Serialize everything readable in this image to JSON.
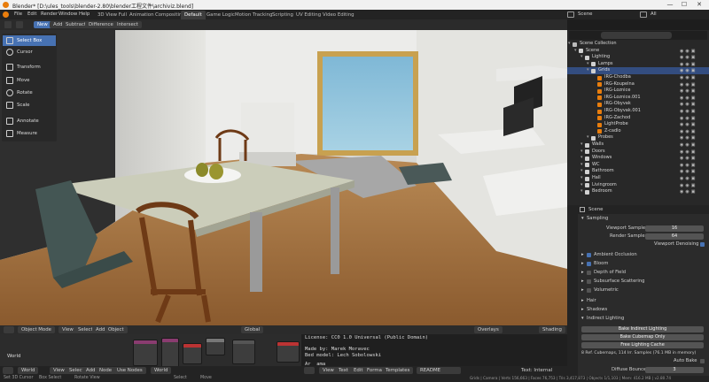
{
  "titlebar": {
    "title": "Blender* [D:\\ules_tools\\blender-2.80\\blender工程文件\\archiviz.blend]",
    "min": "—",
    "max": "☐",
    "close": "✕"
  },
  "menu": [
    "File",
    "Edit",
    "Render",
    "Window",
    "Help"
  ],
  "workspaces": [
    "3D View Full",
    "Animation",
    "Compositing",
    "Default",
    "Game Logic",
    "Motion Tracking",
    "Scripting",
    "UV Editing",
    "Video Editing"
  ],
  "workspace_active": "Default",
  "scene_label": "Scene",
  "viewlayer_label": "All",
  "tool_header": {
    "new": "New",
    "add": "Add",
    "subtract": "Subtract",
    "difference": "Difference",
    "intersect": "Intersect"
  },
  "tools": [
    "Select Box",
    "Cursor",
    "Transform",
    "Move",
    "Rotate",
    "Scale",
    "Annotate",
    "Measure"
  ],
  "vp_footer": {
    "mode": "Object Mode",
    "view": "View",
    "select": "Select",
    "add": "Add",
    "object": "Object",
    "orientation": "Global",
    "overlays": "Overlays",
    "shading": "Shading"
  },
  "node_editor": {
    "world_label": "World",
    "header": {
      "editor": "World",
      "view": "View",
      "select": "Select",
      "add": "Add",
      "node": "Node",
      "use_nodes": "Use Nodes",
      "world": "World"
    }
  },
  "text_editor": {
    "lines": [
      "License: CC0 1.0 Universal (Public Domain)",
      "",
      "Made by: Marek Moravec",
      "Bed model: Lech Sobolowski",
      "",
      "Ar  ama  "
    ],
    "header": {
      "view": "View",
      "text": "Text",
      "edit": "Edit",
      "format": "Format",
      "templates": "Templates",
      "file": "README",
      "status": "Text: Internal"
    }
  },
  "outliner": {
    "search_placeholder": "",
    "rows": [
      {
        "label": "Scene Collection",
        "indent": 0
      },
      {
        "label": "Scene",
        "indent": 1
      },
      {
        "label": "Lighting",
        "indent": 2
      },
      {
        "label": "Lamps",
        "indent": 3
      },
      {
        "label": "Grids",
        "indent": 3,
        "selected": true
      },
      {
        "label": "IRG-Chodba",
        "indent": 4
      },
      {
        "label": "IRG-Koupelna",
        "indent": 4
      },
      {
        "label": "IRG-Loznice",
        "indent": 4
      },
      {
        "label": "IRG-Loznice.001",
        "indent": 4
      },
      {
        "label": "IRG-Obyvak",
        "indent": 4
      },
      {
        "label": "IRG-Obyvak.001",
        "indent": 4
      },
      {
        "label": "IRG-Zachod",
        "indent": 4
      },
      {
        "label": "LightProbe",
        "indent": 4
      },
      {
        "label": "Z-cadlo",
        "indent": 4
      },
      {
        "label": "Probes",
        "indent": 3
      },
      {
        "label": "Walls",
        "indent": 2
      },
      {
        "label": "Doors",
        "indent": 2
      },
      {
        "label": "Windows",
        "indent": 2
      },
      {
        "label": "WC",
        "indent": 2
      },
      {
        "label": "Bathroom",
        "indent": 2
      },
      {
        "label": "Hall",
        "indent": 2
      },
      {
        "label": "Livingroom",
        "indent": 2
      },
      {
        "label": "Bedroom",
        "indent": 2
      }
    ]
  },
  "properties": {
    "scene": "Scene",
    "sampling": "Sampling",
    "viewport_samples_label": "Viewport Samples",
    "viewport_samples": "16",
    "render_samples_label": "Render Samples",
    "render_samples": "64",
    "viewport_denoising": "Viewport Denoising",
    "panels": [
      "Ambient Occlusion",
      "Bloom",
      "Depth of Field",
      "Subsurface Scattering",
      "Volumetric",
      "Hair",
      "Shadows",
      "Indirect Lighting"
    ],
    "bake_indirect": "Bake Indirect Lighting",
    "bake_cubemap": "Bake Cubemap Only",
    "free_cache": "Free Lighting Cache",
    "cache_info": "8 Ref. Cubemaps, 114 Irr. Samples (76.1 MB in memory)",
    "auto_bake": "Auto Bake",
    "diffuse_bounces_label": "Diffuse Bounces",
    "diffuse_bounces": "3"
  },
  "statusbar": {
    "left": [
      "Set 3D Cursor",
      "Box Select",
      "Rotate View",
      "Select",
      "Move"
    ],
    "right": "Grids | Camera | Verts 156,663 | Faces 76,753 | Tris 3,417,873 | Objects 1/1,103 | Mem: 416.2 MB | v2.80.74"
  },
  "colors": {
    "accent": "#4772b3",
    "orange": "#e87d0d",
    "bg": "#1d1d1d",
    "panel": "#2b2b2b"
  }
}
